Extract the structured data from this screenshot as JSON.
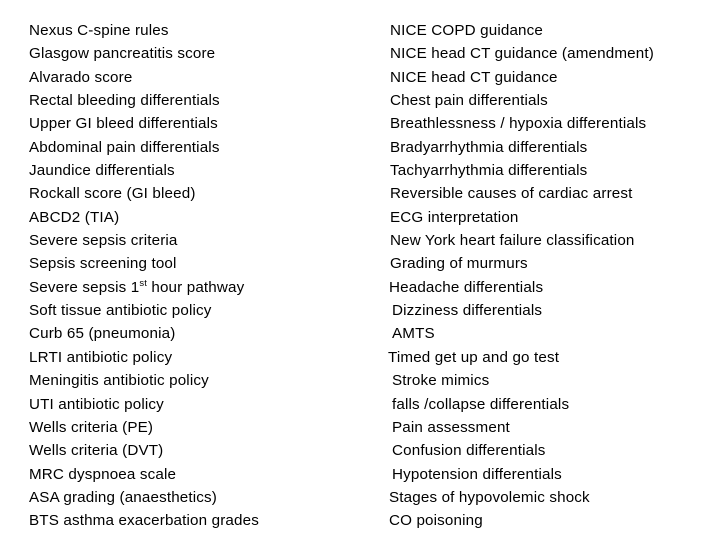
{
  "page": {
    "background_color": "#ffffff",
    "text_color": "#000000",
    "title": "Clinical tools and guidance list"
  },
  "columns": [
    {
      "name": "left-column",
      "items": [
        {
          "text": "Nexus C-spine rules"
        },
        {
          "text": "Glasgow pancreatitis score"
        },
        {
          "text": "Alvarado score"
        },
        {
          "text": "Rectal bleeding differentials"
        },
        {
          "text": "Upper GI bleed differentials"
        },
        {
          "text": "Abdominal pain differentials"
        },
        {
          "text": "Jaundice differentials"
        },
        {
          "text": "Rockall score (GI bleed)"
        },
        {
          "text": "ABCD2 (TIA)"
        },
        {
          "text": "Severe sepsis criteria"
        },
        {
          "text": "Sepsis screening tool"
        },
        {
          "text": "Severe sepsis 1st hour pathway",
          "prefix": "Severe sepsis 1",
          "sup": "st",
          "suffix": " hour pathway"
        },
        {
          "text": "Soft tissue antibiotic policy"
        },
        {
          "text": "Curb 65 (pneumonia)"
        },
        {
          "text": "LRTI antibiotic policy"
        },
        {
          "text": "Meningitis antibiotic policy"
        },
        {
          "text": "UTI antibiotic policy"
        },
        {
          "text": "Wells criteria (PE)"
        },
        {
          "text": "Wells criteria (DVT)"
        },
        {
          "text": "MRC dyspnoea scale"
        },
        {
          "text": "ASA grading (anaesthetics)"
        },
        {
          "text": "BTS asthma exacerbation grades"
        }
      ]
    },
    {
      "name": "right-column",
      "items": [
        {
          "text": "NICE COPD guidance"
        },
        {
          "text": "NICE head CT guidance (amendment)"
        },
        {
          "text": "NICE head CT guidance"
        },
        {
          "text": "Chest pain differentials"
        },
        {
          "text": "Breathlessness / hypoxia differentials"
        },
        {
          "text": "Bradyarrhythmia differentials"
        },
        {
          "text": "Tachyarrhythmia differentials"
        },
        {
          "text": "Reversible causes of cardiac arrest"
        },
        {
          "text": "ECG interpretation"
        },
        {
          "text": "New York heart failure classification"
        },
        {
          "text": "Grading of murmurs"
        },
        {
          "text": "Headache differentials"
        },
        {
          "text": "Dizziness differentials"
        },
        {
          "text": "AMTS"
        },
        {
          "text": "Timed get up and go test"
        },
        {
          "text": "Stroke mimics"
        },
        {
          "text": "falls /collapse  differentials"
        },
        {
          "text": "Pain assessment"
        },
        {
          "text": "Confusion differentials"
        },
        {
          "text": "Hypotension differentials"
        },
        {
          "text": "Stages of hypovolemic shock"
        },
        {
          "text": "CO poisoning"
        }
      ]
    }
  ]
}
